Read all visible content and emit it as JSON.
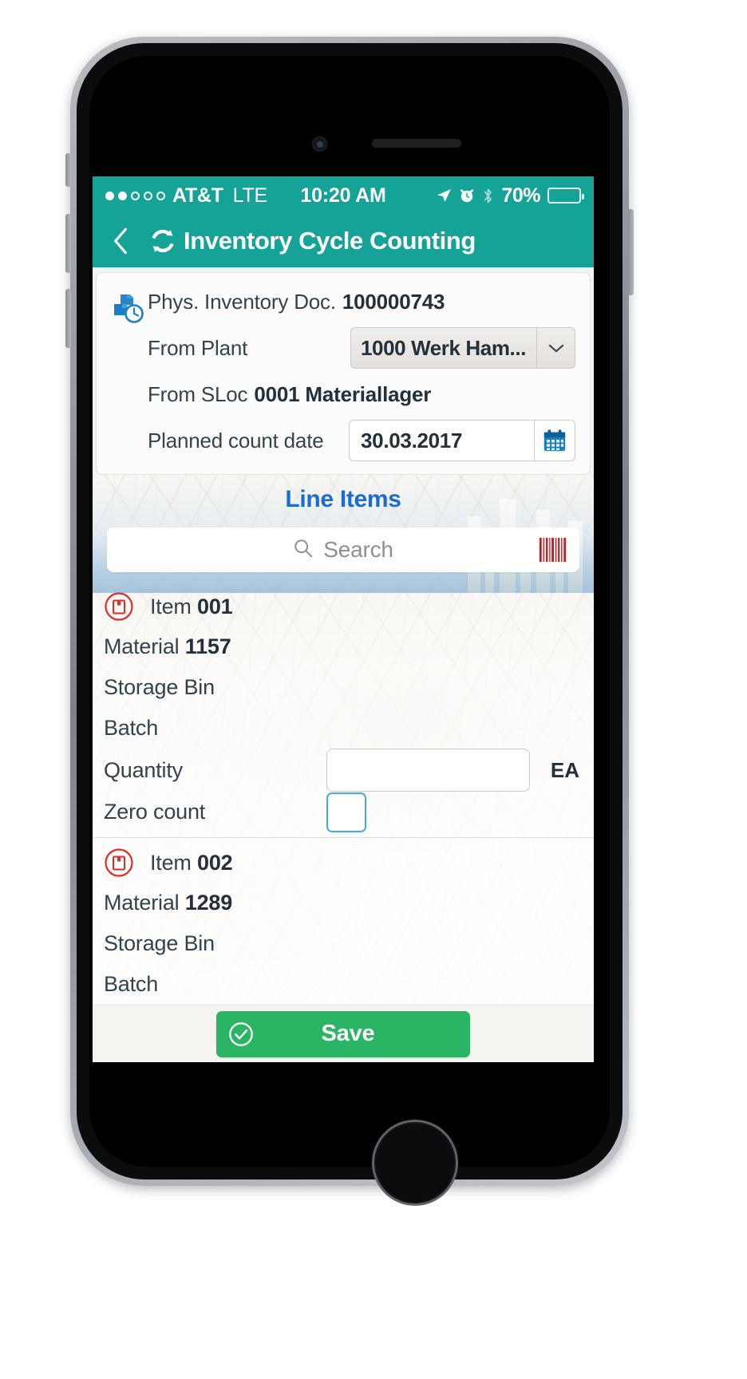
{
  "status_bar": {
    "signal_dots_total": 5,
    "signal_dots_filled": 2,
    "carrier": "AT&T",
    "network": "LTE",
    "time": "10:20 AM",
    "battery_percent": "70%",
    "battery_level": 70,
    "icons": [
      "location-arrow-icon",
      "alarm-clock-icon",
      "bluetooth-icon"
    ]
  },
  "navbar": {
    "back_label": "Back",
    "title": "Inventory Cycle Counting",
    "icon": "cycle-refresh-icon",
    "background_color": "#16a397"
  },
  "header_card": {
    "icon": "inventory-document-clock-icon",
    "doc_label": "Phys. Inventory Doc.",
    "doc_value": "100000743",
    "plant_label": "From Plant",
    "plant_value": "1000 Werk Ham...",
    "plant_caret": "chevron-down-icon",
    "sloc_label": "From SLoc",
    "sloc_value": "0001 Materiallager",
    "date_label": "Planned count date",
    "date_value": "30.03.2017",
    "date_icon": "calendar-icon"
  },
  "line_items_section": {
    "title": "Line Items",
    "title_color": "#1b6cd0"
  },
  "search": {
    "placeholder": "Search",
    "value": "",
    "icon": "search-icon",
    "scan_icon": "barcode-scanner-icon"
  },
  "items": [
    {
      "icon": "item-box-icon",
      "item_label": "Item",
      "item_value": "001",
      "material_label": "Material",
      "material_value": "1157",
      "storage_bin_label": "Storage Bin",
      "storage_bin_value": "",
      "batch_label": "Batch",
      "batch_value": "",
      "quantity_label": "Quantity",
      "quantity_value": "",
      "uom": "EA",
      "zero_count_label": "Zero count",
      "zero_count_checked": false
    },
    {
      "icon": "item-box-icon",
      "item_label": "Item",
      "item_value": "002",
      "material_label": "Material",
      "material_value": "1289",
      "storage_bin_label": "Storage Bin",
      "storage_bin_value": "",
      "batch_label": "Batch",
      "batch_value": ""
    }
  ],
  "footer": {
    "save_label": "Save",
    "save_icon": "check-circle-icon",
    "save_color": "#2ab463"
  }
}
